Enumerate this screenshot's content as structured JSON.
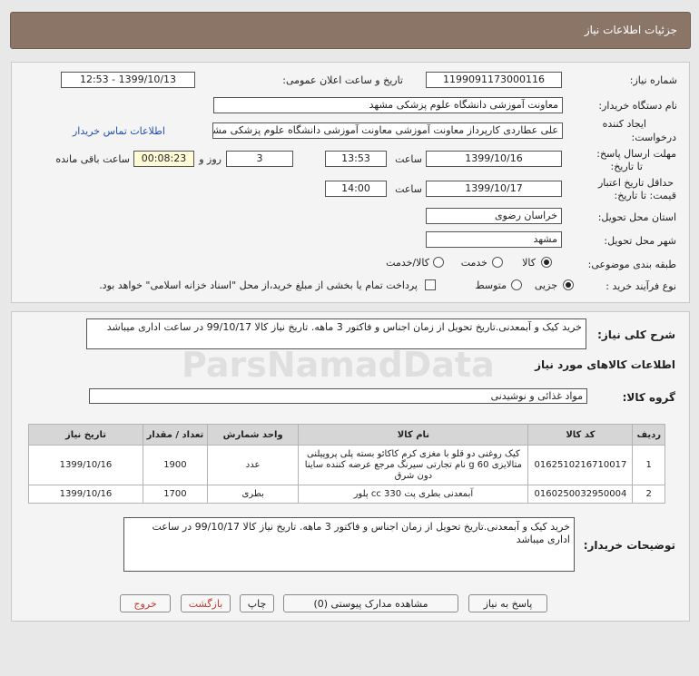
{
  "header": {
    "title": "جزئیات اطلاعات نیاز"
  },
  "info": {
    "need_number_label": "شماره نیاز:",
    "need_number": "1199091173000116",
    "announce_label": "تاریخ و ساعت اعلان عمومی:",
    "announce_value": "1399/10/13 - 12:53",
    "buyer_label": "نام دستگاه خریدار:",
    "buyer_value": "معاونت آموزشی دانشگاه علوم پزشکی مشهد",
    "creator_label_1": "ایجاد کننده",
    "creator_label_2": "درخواست:",
    "creator_value": "علی عطاردی کارپرداز معاونت آموزشی معاونت آموزشی دانشگاه علوم پزشکی مشهد",
    "contact_link": "اطلاعات تماس خریدار",
    "deadline_label_1": "مهلت ارسال پاسخ:",
    "deadline_label_2": "تا تاریخ:",
    "deadline_date": "1399/10/16",
    "time_label": "ساعت",
    "deadline_time": "13:53",
    "days_value": "3",
    "days_label": "روز و",
    "remaining_value": "00:08:23",
    "remaining_label": "ساعت باقی مانده",
    "validity_label_1": "حداقل تاریخ اعتبار",
    "validity_label_2": "قیمت: تا تاریخ:",
    "validity_date": "1399/10/17",
    "validity_time_label": "ساعت",
    "validity_time": "14:00",
    "province_label": "استان محل تحویل:",
    "province_value": "خراسان رضوی",
    "city_label": "شهر محل تحویل:",
    "city_value": "مشهد",
    "category_label": "طبقه بندی موضوعی:",
    "category_options": [
      "کالا",
      "خدمت",
      "کالا/خدمت"
    ],
    "process_label": "نوع فرآیند خرید :",
    "process_options": [
      "جزیی",
      "متوسط"
    ],
    "payment_note": "پرداخت تمام یا بخشی از مبلغ خرید،از محل \"اسناد خزانه اسلامی\" خواهد بود."
  },
  "description": {
    "label": "شرح کلی نیاز:",
    "text": "خرید کیک و آبمعدنی.تاریخ تحویل از زمان اجناس و فاکتور 3 ماهه. تاریخ  نیاز کالا 99/10/17 در ساعت اداری میباشد"
  },
  "goods": {
    "title": "اطلاعات کالاهای مورد نیاز",
    "group_label": "گروه کالا:",
    "group_value": "مواد غذائی و نوشیدنی",
    "columns": [
      "ردیف",
      "کد کالا",
      "نام کالا",
      "واحد شمارش",
      "تعداد / مقدار",
      "تاریخ نیاز"
    ],
    "rows": [
      {
        "row": "1",
        "code": "0162510216710017",
        "name": "کیک روغنی دو قلو با مغزی کرم کاکائو بسته پلی پروپیلنی متالایزی 60 g نام تجارتی سیرنگ مرجع عرضه کننده ساینا دون شرق",
        "unit": "عدد",
        "qty": "1900",
        "date": "1399/10/16"
      },
      {
        "row": "2",
        "code": "0160250032950004",
        "name": "آبمعدنی بطری پت 330 cc پلور",
        "unit": "بطری",
        "qty": "1700",
        "date": "1399/10/16"
      }
    ]
  },
  "buyer_notes": {
    "label": "توضیحات خریدار:",
    "text": "خرید کیک و آبمعدنی.تاریخ تحویل از زمان اجناس و فاکتور 3 ماهه. تاریخ  نیاز کالا 99/10/17 در ساعت اداری میباشد"
  },
  "buttons": {
    "reply": "پاسخ به نیاز",
    "attachments": "مشاهده مدارک پیوستی (0)",
    "print": "چاپ",
    "back": "بازگشت",
    "exit": "خروج"
  },
  "watermark": {
    "brand": "ParsNamadData"
  }
}
